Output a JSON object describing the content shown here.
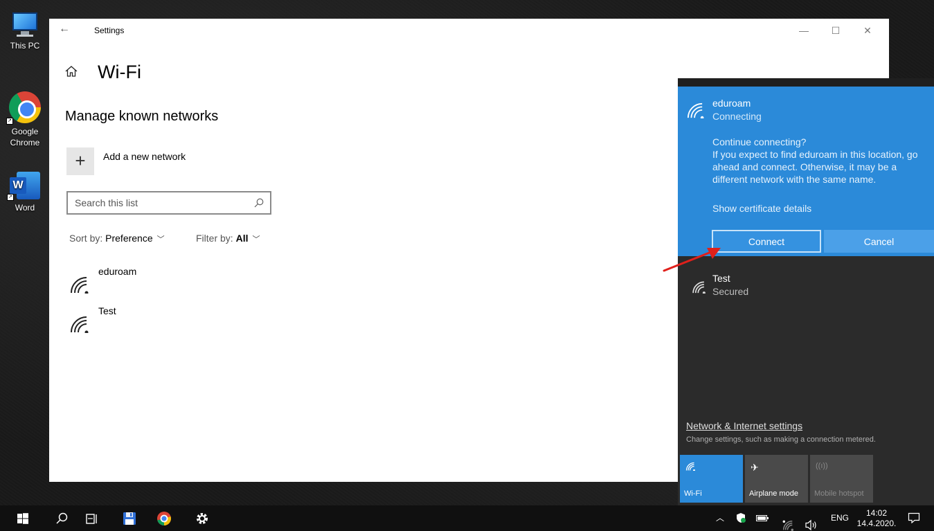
{
  "desktop": {
    "icons": [
      {
        "label": "This PC"
      },
      {
        "label": "Google Chrome"
      },
      {
        "label": "Word"
      }
    ]
  },
  "settings": {
    "app_title": "Settings",
    "page_title": "Wi-Fi",
    "section_title": "Manage known networks",
    "add_network_label": "Add a new network",
    "search": {
      "placeholder": "Search this list",
      "value": ""
    },
    "sort": {
      "prefix": "Sort by: ",
      "value": "Preference"
    },
    "filter": {
      "prefix": "Filter by: ",
      "value": "All"
    },
    "networks": [
      {
        "name": "eduroam"
      },
      {
        "name": "Test"
      }
    ]
  },
  "flyout": {
    "active_network": {
      "name": "eduroam",
      "status": "Connecting",
      "prompt_question": "Continue connecting?",
      "prompt_body": "If you expect to find eduroam in this location, go ahead and connect. Otherwise, it may be a different network with the same name.",
      "certificate_link": "Show certificate details",
      "connect_label": "Connect",
      "cancel_label": "Cancel"
    },
    "other_network": {
      "name": "Test",
      "status": "Secured"
    },
    "settings_link": "Network & Internet settings",
    "settings_desc": "Change settings, such as making a connection metered.",
    "tiles": [
      {
        "label": "Wi-Fi",
        "active": true
      },
      {
        "label": "Airplane mode",
        "active": false
      },
      {
        "label": "Mobile hotspot",
        "active": false
      }
    ],
    "colors": {
      "accent": "#2b8ad9",
      "background": "#2b2b2b"
    }
  },
  "taskbar": {
    "language": "ENG",
    "time": "14:02",
    "date": "14.4.2020."
  }
}
